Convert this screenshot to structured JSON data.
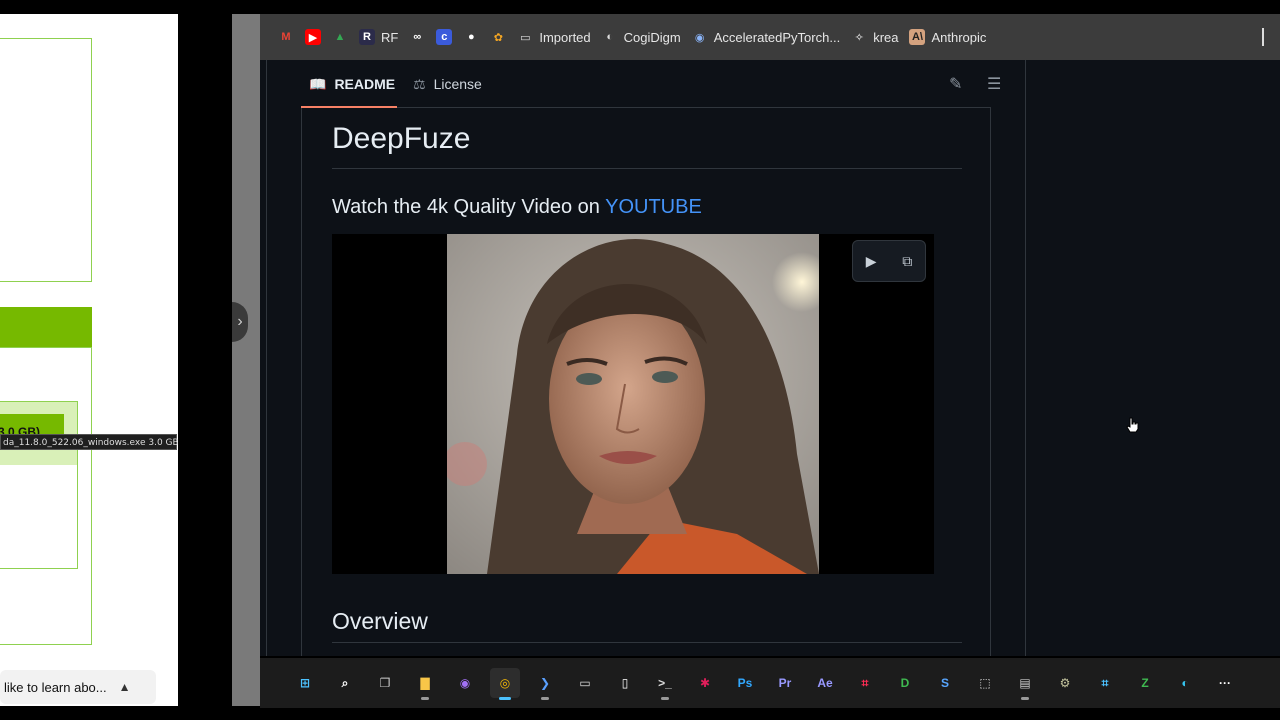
{
  "left_panel": {
    "badge_text": "3.0 GB)",
    "tooltip_text": "da_11.8.0_522.06_windows.exe 3.0 GB",
    "bottom_bar_text": "like to learn abo..."
  },
  "bookmarks": [
    {
      "name": "gmail",
      "label": "",
      "icon": "M",
      "color": "#ea4335",
      "bg": "transparent"
    },
    {
      "name": "youtube",
      "label": "",
      "icon": "▶",
      "color": "#fff",
      "bg": "#ff0000"
    },
    {
      "name": "google-drive",
      "label": "",
      "icon": "▲",
      "color": "#34a853",
      "bg": "transparent"
    },
    {
      "name": "rf",
      "label": "RF",
      "icon": "R",
      "color": "#fff",
      "bg": "#2b2b4a"
    },
    {
      "name": "link",
      "label": "",
      "icon": "∞",
      "color": "#fff",
      "bg": "transparent"
    },
    {
      "name": "c-app",
      "label": "",
      "icon": "c",
      "color": "#fff",
      "bg": "#3b5bdb"
    },
    {
      "name": "github",
      "label": "",
      "icon": "●",
      "color": "#fff",
      "bg": "transparent"
    },
    {
      "name": "ollama",
      "label": "",
      "icon": "✿",
      "color": "#f5a623",
      "bg": "transparent"
    },
    {
      "name": "imported",
      "label": "Imported",
      "icon": "▭",
      "color": "#ddd",
      "bg": "transparent"
    },
    {
      "name": "cogidigm",
      "label": "CogiDigm",
      "icon": "◐",
      "color": "#ddd",
      "bg": "transparent"
    },
    {
      "name": "accelerated-pytorch",
      "label": "AcceleratedPyTorch...",
      "icon": "◉",
      "color": "#8ab4f8",
      "bg": "transparent"
    },
    {
      "name": "krea",
      "label": "krea",
      "icon": "✧",
      "color": "#fff",
      "bg": "transparent"
    },
    {
      "name": "anthropic",
      "label": "Anthropic",
      "icon": "A\\",
      "color": "#222",
      "bg": "#d4a27f"
    }
  ],
  "readme": {
    "tabs": {
      "readme": "README",
      "license": "License"
    },
    "title": "DeepFuze",
    "subtitle_prefix": "Watch the 4k Quality Video on ",
    "subtitle_link": "YOUTUBE",
    "overview": "Overview"
  },
  "left_tab_icon": "›",
  "taskbar": [
    {
      "name": "start",
      "label": "⊞",
      "color": "#4cc2ff"
    },
    {
      "name": "search",
      "label": "⌕",
      "color": "#fff"
    },
    {
      "name": "task-view",
      "label": "❐",
      "color": "#ccc"
    },
    {
      "name": "file-explorer",
      "label": "▇",
      "color": "#f8c648"
    },
    {
      "name": "github-desktop",
      "label": "◉",
      "color": "#a371f7"
    },
    {
      "name": "chrome",
      "label": "◎",
      "color": "#fbbc04",
      "active": true
    },
    {
      "name": "powershell",
      "label": "❯",
      "color": "#5aa0ff"
    },
    {
      "name": "window-app",
      "label": "▭",
      "color": "#ddd"
    },
    {
      "name": "document",
      "label": "▯",
      "color": "#fff"
    },
    {
      "name": "terminal",
      "label": ">_",
      "color": "#ddd"
    },
    {
      "name": "slack",
      "label": "✱",
      "color": "#e01e5a"
    },
    {
      "name": "photoshop",
      "label": "Ps",
      "color": "#31a8ff"
    },
    {
      "name": "premiere",
      "label": "Pr",
      "color": "#9999ff"
    },
    {
      "name": "after-effects",
      "label": "Ae",
      "color": "#9999ff"
    },
    {
      "name": "crop-tool",
      "label": "⌗",
      "color": "#ff2d55"
    },
    {
      "name": "shield-d",
      "label": "D",
      "color": "#3fb950"
    },
    {
      "name": "shield-s",
      "label": "S",
      "color": "#58a6ff"
    },
    {
      "name": "camera",
      "label": "⬚",
      "color": "#ddd"
    },
    {
      "name": "store",
      "label": "▤",
      "color": "#ccc"
    },
    {
      "name": "gear-app",
      "label": "⚙",
      "color": "#c8c8a0"
    },
    {
      "name": "snip",
      "label": "⌗",
      "color": "#4cc2ff"
    },
    {
      "name": "zip-app",
      "label": "Z",
      "color": "#3fb950"
    },
    {
      "name": "edge",
      "label": "◐",
      "color": "#36c5f0"
    },
    {
      "name": "more",
      "label": "···",
      "color": "#fff"
    }
  ]
}
